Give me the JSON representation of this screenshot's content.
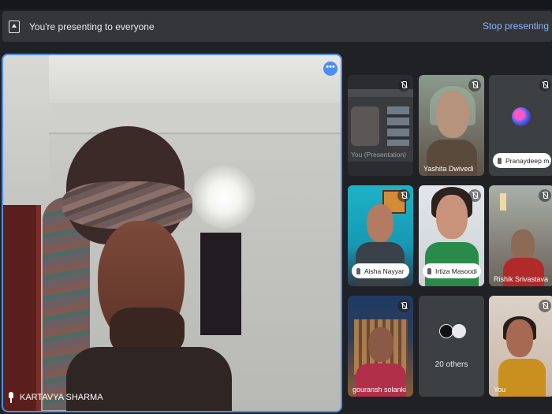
{
  "banner": {
    "presenting_text": "You're presenting to everyone",
    "stop_label": "Stop presenting"
  },
  "main": {
    "participant_name": "KARTAVYA SHARMA",
    "more_label": "•••"
  },
  "tiles": [
    {
      "name": "You (Presentation)",
      "kind": "presentation",
      "muted": true
    },
    {
      "name": "Yashita Dwivedi",
      "kind": "video",
      "muted": true
    },
    {
      "name": "Pranaydeep m...",
      "kind": "avatar",
      "muted": true
    },
    {
      "name": "Aisha Nayyar",
      "kind": "video",
      "muted": true
    },
    {
      "name": "Irtiza Masoodi",
      "kind": "video",
      "muted": true
    },
    {
      "name": "Rishik Srivastava",
      "kind": "video",
      "muted": true
    },
    {
      "name": "gouransh solanki",
      "kind": "video",
      "muted": true
    },
    {
      "name": "20 others",
      "kind": "others",
      "muted": false
    },
    {
      "name": "You",
      "kind": "video",
      "muted": true
    }
  ],
  "icons": {
    "present": "present-to-all-icon",
    "pin": "pin-icon",
    "mic_off": "mic-off-icon",
    "more": "more-options-icon"
  },
  "colors": {
    "accent": "#8ab4f8",
    "active_border": "#4c8df6",
    "banner_bg": "#35363a",
    "page_bg": "#202124"
  }
}
